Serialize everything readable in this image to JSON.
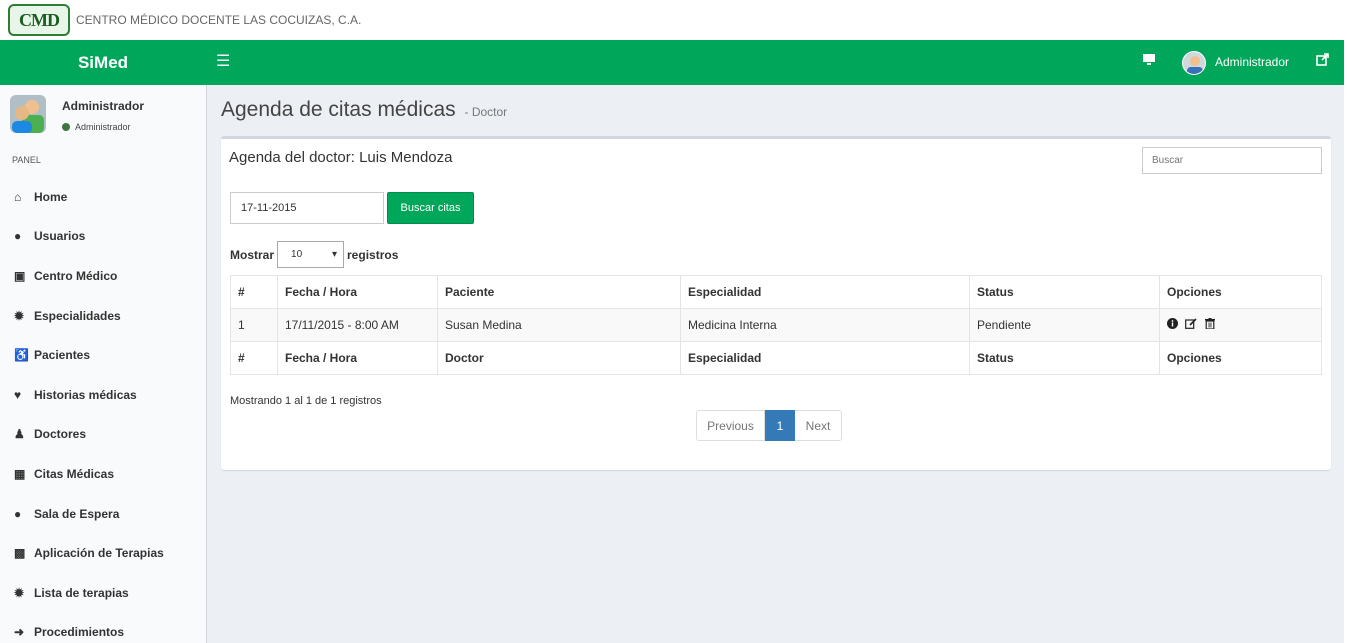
{
  "brand": {
    "logo_text": "CMD",
    "org_name": "CENTRO MÉDICO DOCENTE LAS COCUIZAS, C.A."
  },
  "topbar": {
    "app_name": "SiMed",
    "user_name": "Administrador",
    "color": "#00a65a"
  },
  "sidebar": {
    "user_name": "Administrador",
    "user_role": "Administrador",
    "panel_header": "PANEL",
    "items": [
      {
        "label": "Home",
        "icon": "home-icon"
      },
      {
        "label": "Usuarios",
        "icon": "users-icon"
      },
      {
        "label": "Centro Médico",
        "icon": "building-icon"
      },
      {
        "label": "Especialidades",
        "icon": "gear-icon"
      },
      {
        "label": "Pacientes",
        "icon": "wheelchair-icon"
      },
      {
        "label": "Historias médicas",
        "icon": "heartbeat-icon"
      },
      {
        "label": "Doctores",
        "icon": "user-md-icon"
      },
      {
        "label": "Citas Médicas",
        "icon": "calendar-icon"
      },
      {
        "label": "Sala de Espera",
        "icon": "users-icon"
      },
      {
        "label": "Aplicación de Terapias",
        "icon": "medkit-icon"
      },
      {
        "label": "Lista de terapias",
        "icon": "gear-icon"
      },
      {
        "label": "Procedimientos",
        "icon": "arrow-circle-icon"
      }
    ]
  },
  "content": {
    "title": "Agenda de citas médicas",
    "subtitle": "- Doctor",
    "box_title": "Agenda del doctor: Luis Mendoza",
    "search_placeholder": "Buscar",
    "date_value": "17-11-2015",
    "search_button": "Buscar citas",
    "show_label": "Mostrar",
    "show_value": "10",
    "records_label": "registros",
    "table": {
      "headers": [
        "#",
        "Fecha / Hora",
        "Paciente",
        "Especialidad",
        "Status",
        "Opciones"
      ],
      "rows": [
        {
          "num": "1",
          "datetime": "17/11/2015 - 8:00 AM",
          "patient": "Susan Medina",
          "specialty": "Medicina Interna",
          "status": "Pendiente"
        }
      ],
      "footer": [
        "#",
        "Fecha / Hora",
        "Doctor",
        "Especialidad",
        "Status",
        "Opciones"
      ]
    },
    "info_text": "Mostrando 1 al 1 de 1 registros",
    "pager": {
      "previous": "Previous",
      "current": "1",
      "next": "Next"
    }
  }
}
